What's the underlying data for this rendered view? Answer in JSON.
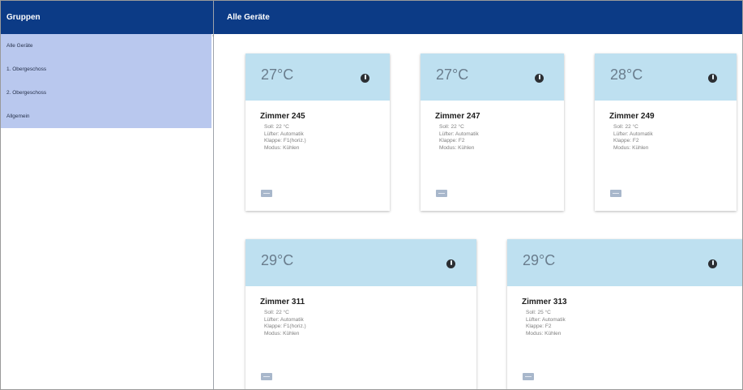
{
  "sidebar": {
    "title": "Gruppen",
    "items": [
      "Alle Geräte",
      "1. Obergeschoss",
      "2. Obergeschoss",
      "Allgemein"
    ]
  },
  "main": {
    "title": "Alle Geräte"
  },
  "devices": [
    {
      "temp": "27°C",
      "name": "Zimmer 245",
      "soll": "Soll: 22 °C",
      "luefter": "Lüfter: Automatik",
      "klappe": "Klappe: F1(horiz.)",
      "modus": "Modus: Kühlen"
    },
    {
      "temp": "27°C",
      "name": "Zimmer 247",
      "soll": "Soll: 22 °C",
      "luefter": "Lüfter: Automatik",
      "klappe": "Klappe: F2",
      "modus": "Modus: Kühlen"
    },
    {
      "temp": "28°C",
      "name": "Zimmer 249",
      "soll": "Soll: 22 °C",
      "luefter": "Lüfter: Automatik",
      "klappe": "Klappe: F2",
      "modus": "Modus: Kühlen"
    },
    {
      "temp": "29°C",
      "name": "Zimmer 311",
      "soll": "Soll: 22 °C",
      "luefter": "Lüfter: Automatik",
      "klappe": "Klappe: F1(horiz.)",
      "modus": "Modus: Kühlen"
    },
    {
      "temp": "29°C",
      "name": "Zimmer 313",
      "soll": "Soll: 25 °C",
      "luefter": "Lüfter: Automatik",
      "klappe": "Klappe: F2",
      "modus": "Modus: Kühlen"
    }
  ],
  "icons": {
    "power": "power-icon",
    "edit": "edit-icon"
  },
  "colors": {
    "header": "#0c3b86",
    "sidebar_list": "#b9c8ee",
    "card_top": "#bee0f0",
    "edit_button": "#a8b7cb"
  }
}
